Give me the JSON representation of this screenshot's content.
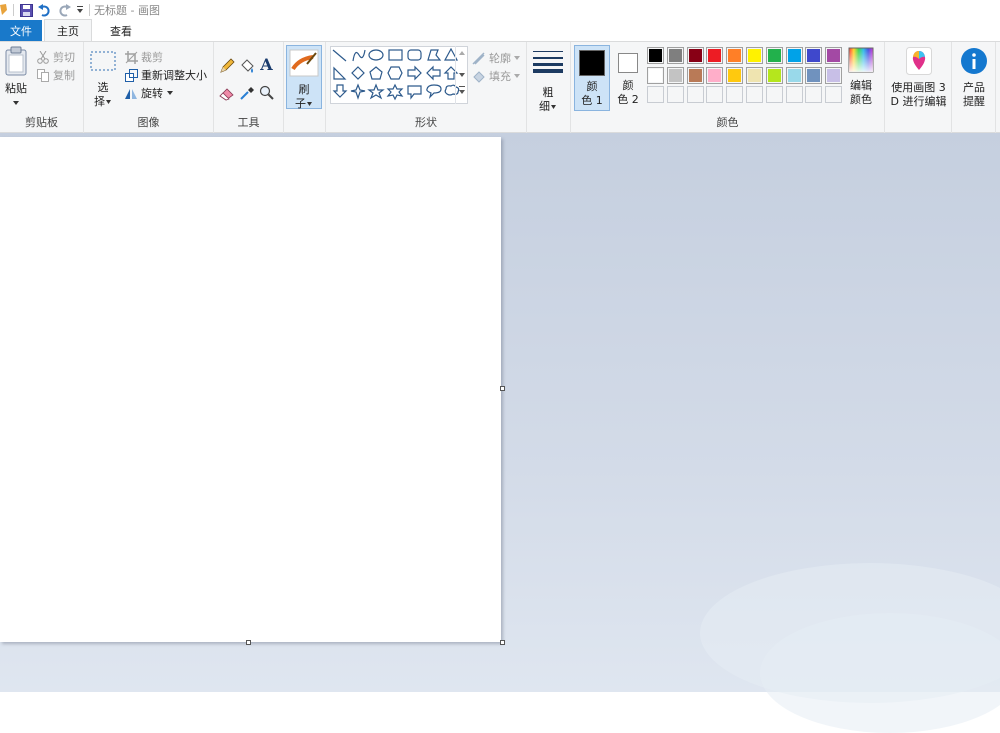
{
  "window": {
    "title": "无标题 - 画图"
  },
  "tabs": {
    "file": "文件",
    "home": "主页",
    "view": "查看"
  },
  "clipboard": {
    "paste": "粘贴",
    "cut": "剪切",
    "copy": "复制",
    "group": "剪贴板"
  },
  "image": {
    "select_1": "选",
    "select_2": "择",
    "crop": "裁剪",
    "resize": "重新调整大小",
    "rotate": "旋转",
    "group": "图像"
  },
  "tools": {
    "group": "工具",
    "text_tool": "A"
  },
  "brushes": {
    "label_1": "刷",
    "label_2": "子"
  },
  "shapes": {
    "outline": "轮廓",
    "fill": "填充",
    "group": "形状"
  },
  "size": {
    "label_1": "粗",
    "label_2": "细"
  },
  "colors": {
    "color1_1": "颜",
    "color1_2": "色 1",
    "color2_1": "颜",
    "color2_2": "色 2",
    "edit_1": "编辑",
    "edit_2": "颜色",
    "group": "颜色",
    "color1_value": "#000000",
    "color2_value": "#ffffff",
    "palette_row1": [
      "#000000",
      "#7f7f7f",
      "#880015",
      "#ed1c24",
      "#ff7f27",
      "#fff200",
      "#22b14c",
      "#00a2e8",
      "#3f48cc",
      "#a349a4"
    ],
    "palette_row2": [
      "#ffffff",
      "#c3c3c3",
      "#b97a57",
      "#ffaec9",
      "#ffc90e",
      "#efe4b0",
      "#b5e61d",
      "#99d9ea",
      "#7092be",
      "#c8bfe7"
    ]
  },
  "paint3d": {
    "label_1": "使用画图 3",
    "label_2": "D 进行编辑"
  },
  "product": {
    "label_1": "产品",
    "label_2": "提醒"
  }
}
